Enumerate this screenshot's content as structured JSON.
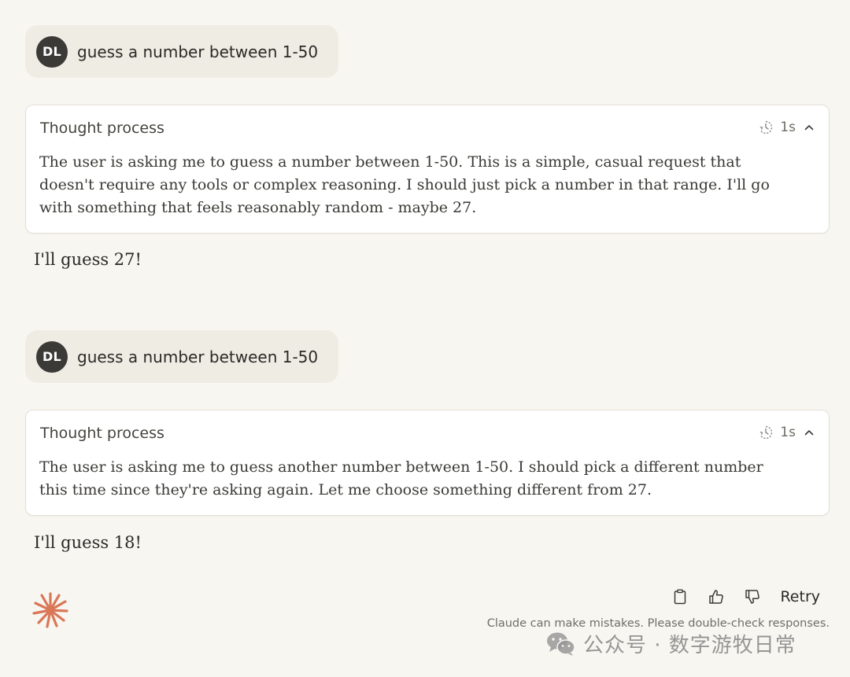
{
  "conversation": [
    {
      "user": {
        "avatar_initials": "DL",
        "text": "guess a number between 1-50"
      },
      "thought": {
        "title": "Thought process",
        "duration": "1s",
        "body": "The user is asking me to guess a number between 1-50. This is a simple, casual request that doesn't require any tools or complex reasoning. I should just pick a number in that range. I'll go with something that feels reasonably random - maybe 27."
      },
      "reply": "I'll guess 27!"
    },
    {
      "user": {
        "avatar_initials": "DL",
        "text": "guess a number between 1-50"
      },
      "thought": {
        "title": "Thought process",
        "duration": "1s",
        "body": "The user is asking me to guess another number between 1-50. I should pick a different number this time since they're asking again. Let me choose something different from 27."
      },
      "reply": "I'll guess 18!"
    }
  ],
  "actions": {
    "copy_icon": "clipboard-icon",
    "thumbs_up_icon": "thumbs-up-icon",
    "thumbs_down_icon": "thumbs-down-icon",
    "retry_label": "Retry"
  },
  "disclaimer": "Claude can make mistakes. Please double-check responses.",
  "watermark": {
    "text": "公众号 · 数字游牧日常"
  },
  "colors": {
    "background": "#f8f6f1",
    "user_bubble": "#efece4",
    "avatar": "#3b3a36",
    "claude_accent": "#d97757"
  }
}
